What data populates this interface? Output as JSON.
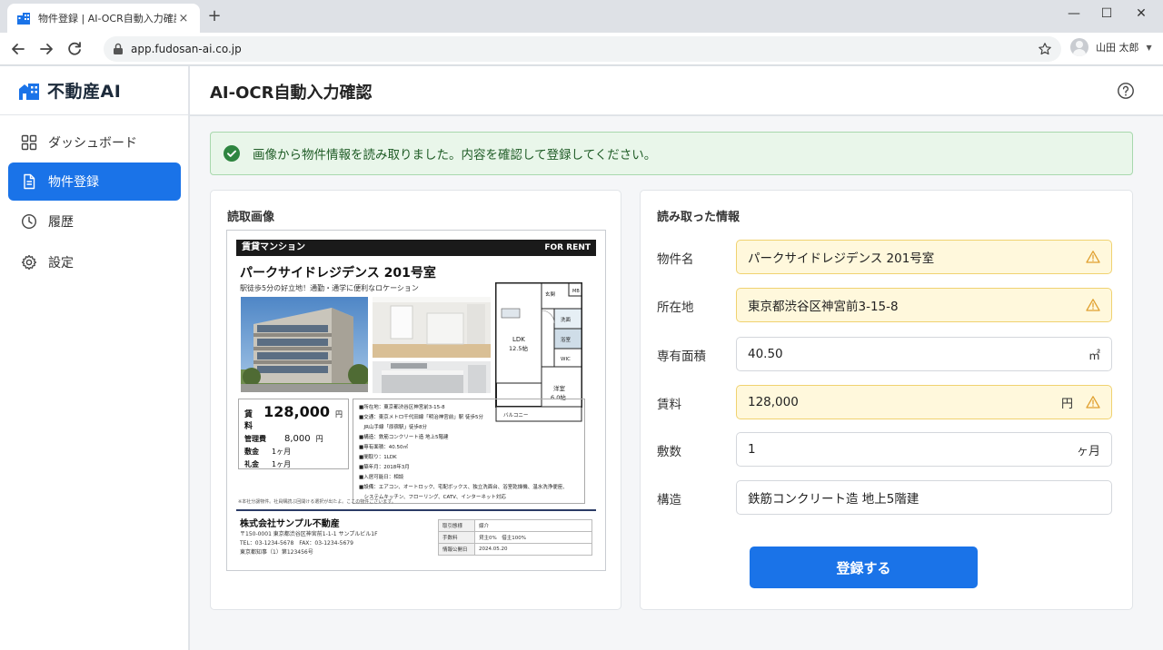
{
  "browser": {
    "tab_title": "物件登録 | AI-OCR自動入力確認",
    "tab_close": "×",
    "new_tab": "+",
    "url": "app.fudosan-ai.co.jp",
    "user_name": "山田 太郎",
    "window_controls": {
      "minimize": "—",
      "maximize": "☐",
      "close": "✕"
    }
  },
  "brand": {
    "name": "不動産AI",
    "color": "#1a73e8"
  },
  "sidebar": {
    "items": [
      {
        "label": "ダッシュボード",
        "icon": "grid-icon",
        "active": false
      },
      {
        "label": "物件登録",
        "icon": "document-icon",
        "active": true
      },
      {
        "label": "履歴",
        "icon": "clock-icon",
        "active": false
      },
      {
        "label": "設定",
        "icon": "gear-icon",
        "active": false
      }
    ]
  },
  "header": {
    "title": "AI-OCR自動入力確認",
    "help_icon": "help-circle-icon"
  },
  "alert": {
    "text": "画像から物件情報を読み取りました。内容を確認して登録してください。",
    "icon": "check-circle-icon"
  },
  "left_card": {
    "title": "読取画像"
  },
  "flyer": {
    "band_left": "賃貸マンション",
    "band_right": "FOR RENT",
    "title": "パークサイドレジデンス 201号室",
    "catch": "駅徒歩5分の好立地！通勤・通学に便利なロケーション",
    "floorplan": {
      "mb": "MB",
      "entrance": "玄関",
      "wash": "洗面",
      "bath": "浴室",
      "wic": "WIC",
      "ldk": "LDK",
      "ldk_size": "12.5帖",
      "western": "洋室",
      "western_size": "6.0帖",
      "balcony": "バルコニー"
    },
    "price_label": "賃料",
    "price_value": "128,000",
    "price_unit": "円",
    "mgmt_label": "管理費",
    "mgmt_value": "8,000",
    "mgmt_unit": "円",
    "deposit_label": "敷金",
    "deposit_value": "1ヶ月",
    "key_label": "礼金",
    "key_value": "1ヶ月",
    "details": [
      "■所在地：東京都渋谷区神宮前3-15-8",
      "■交通：東京メトロ千代田線「明治神宮前」駅 徒歩5分",
      "　JR山手線「原宿駅」徒歩8分",
      "■構造：鉄筋コンクリート造 地上5階建",
      "■専有面積：40.50㎡",
      "■間取り：1LDK",
      "■築年月：2018年3月",
      "■入居可能日：相談",
      "■設備：エアコン、オートロック、宅配ボックス、独立洗面台、浴室乾燥機、温水洗浄便座、",
      "　システムキッチン、フローリング、CATV、インターネット対応"
    ],
    "note": "※本社分譲物件。社員購読ぶ回開ける選択が出たよ。ここの物件ございます。",
    "company": "株式会社サンプル不動産",
    "address_lines": [
      "〒150-0001 東京都渋谷区神宮前1-1-1 サンプルビル1F",
      "TEL：03-1234-5678　FAX：03-1234-5679",
      "東京都知事（1）第123456号"
    ],
    "table": [
      {
        "k": "取引態様",
        "v": "媒介"
      },
      {
        "k": "手数料",
        "v": "貸主0%　借主100%"
      },
      {
        "k": "情報公開日",
        "v": "2024.05.20"
      }
    ]
  },
  "right_card": {
    "title": "読み取った情報"
  },
  "form": {
    "fields": [
      {
        "label": "物件名",
        "value": "パークサイドレジデンス 201号室",
        "unit": "",
        "warning": true
      },
      {
        "label": "所在地",
        "value": "東京都渋谷区神宮前3-15-8",
        "unit": "",
        "warning": true
      },
      {
        "label": "専有面積",
        "value": "40.50",
        "unit": "㎡",
        "warning": false
      },
      {
        "label": "賃料",
        "value": "128,000",
        "unit": "円",
        "warning": true
      },
      {
        "label": "敷数",
        "value": "1",
        "unit": "ヶ月",
        "warning": false
      },
      {
        "label": "構造",
        "value": "鉄筋コンクリート造 地上5階建",
        "unit": "",
        "warning": false
      }
    ],
    "submit_label": "登録する"
  },
  "colors": {
    "primary": "#1a73e8",
    "success_bg": "#e9f6ea",
    "success_text": "#1f5c26",
    "warn_bg": "#fff8dc",
    "warn_border": "#f0d270",
    "warn_icon": "#e0a030"
  }
}
